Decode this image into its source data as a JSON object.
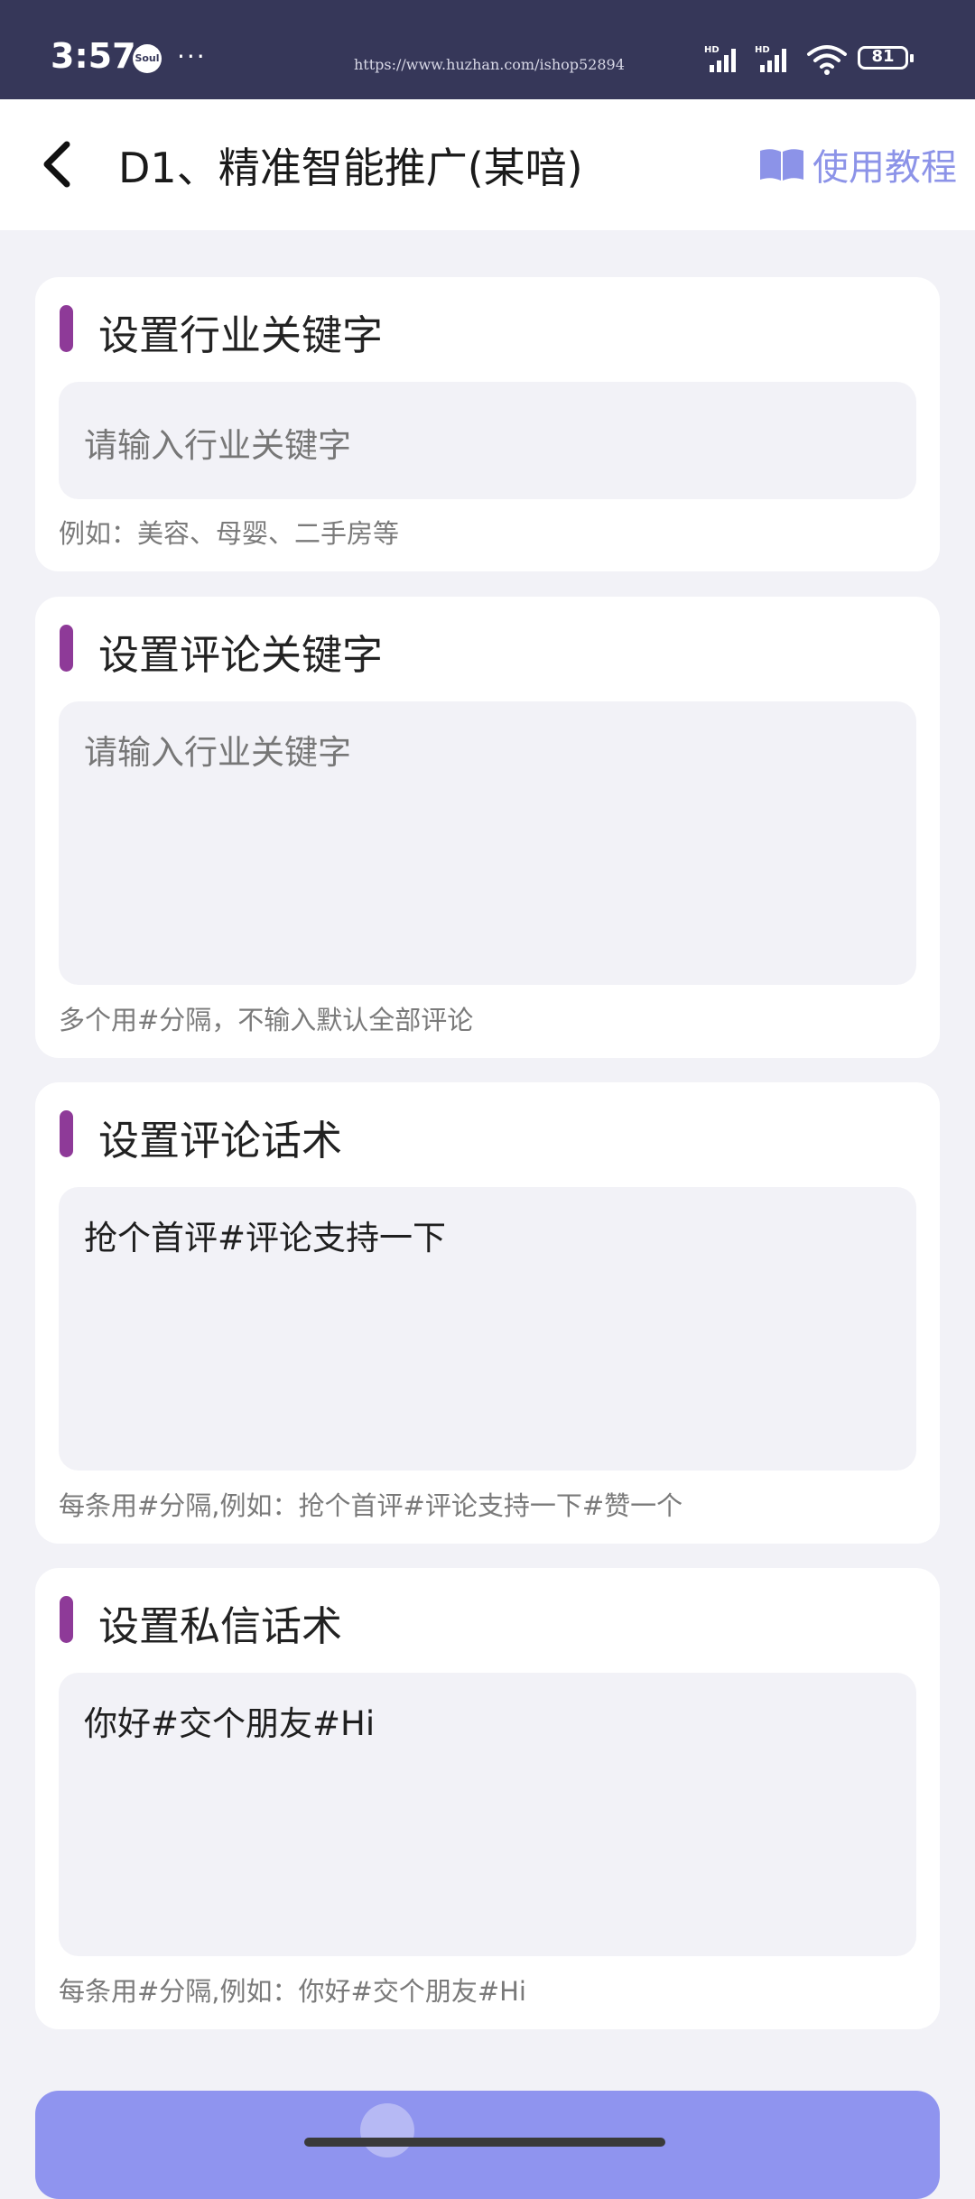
{
  "status_bar": {
    "time": "3:57",
    "app_icon_label": "Soul",
    "more": "···",
    "watermark": "https://www.huzhan.com/ishop52894",
    "battery": "81",
    "icons": [
      "hd-signal-icon",
      "hd-signal-icon",
      "wifi-icon",
      "battery-icon"
    ]
  },
  "header": {
    "title": "D1、精准智能推广(某喑)",
    "tutorial_label": "使用教程",
    "back_icon": "chevron-left-icon",
    "tutorial_icon": "book-icon"
  },
  "sections": [
    {
      "title": "设置行业关键字",
      "placeholder": "请输入行业关键字",
      "value": "",
      "hint": "例如：美容、母婴、二手房等"
    },
    {
      "title": "设置评论关键字",
      "placeholder": "请输入行业关键字",
      "value": "",
      "hint": "多个用#分隔，不输入默认全部评论"
    },
    {
      "title": "设置评论话术",
      "placeholder": "",
      "value": "抢个首评#评论支持一下",
      "hint": "每条用#分隔,例如：抢个首评#评论支持一下#赞一个"
    },
    {
      "title": "设置私信话术",
      "placeholder": "",
      "value": "你好#交个朋友#Hi",
      "hint": "每条用#分隔,例如：你好#交个朋友#Hi"
    }
  ],
  "colors": {
    "status_bar": "#363759",
    "accent_bar": "#8e3a98",
    "link": "#8c93e8",
    "submit_button": "#8f94ef",
    "page_background": "#f2f2f7"
  }
}
